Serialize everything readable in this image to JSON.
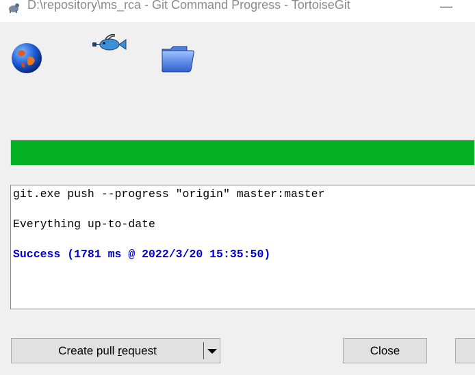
{
  "window": {
    "title": "D:\\repository\\ms_rca - Git Command Progress - TortoiseGit",
    "minimize_glyph": "—",
    "app_icon": "tortoisegit-turtle-icon"
  },
  "animation": {
    "icons": [
      "globe-icon",
      "flying-fish-icon",
      "folder-icon"
    ]
  },
  "progress": {
    "value_percent": 100,
    "color": "#06b025"
  },
  "log": {
    "lines": [
      "git.exe push --progress \"origin\" master:master",
      "Everything up-to-date",
      "Success (1781 ms @ 2022/3/20 15:35:50)"
    ],
    "success_color": "#0000cc"
  },
  "buttons": {
    "create_pull_request_prefix": "Create pull ",
    "create_pull_request_mnemonic": "r",
    "create_pull_request_suffix": "equest",
    "close": "Close"
  }
}
